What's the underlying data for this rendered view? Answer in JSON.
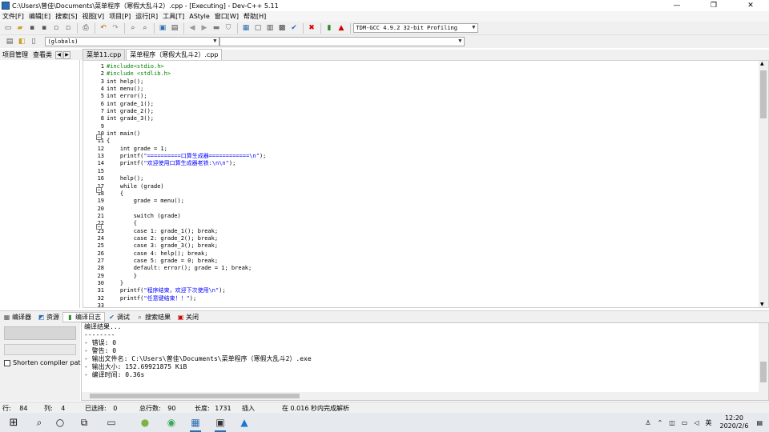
{
  "window": {
    "title": "C:\\Users\\曾佳\\Documents\\菜单程序（寒假大乱斗2）.cpp - [Executing] - Dev-C++ 5.11",
    "minimize": "—",
    "maximize": "❐",
    "close": "✕"
  },
  "menu": [
    "文件[F]",
    "编辑[E]",
    "搜索[S]",
    "视图[V]",
    "项目[P]",
    "运行[R]",
    "工具[T]",
    "AStyle",
    "窗口[W]",
    "帮助[H]"
  ],
  "toolbar": {
    "compiler_select": "TDM-GCC 4.9.2 32-bit Profiling",
    "globals_select": "(globals)"
  },
  "left_tabs": [
    "项目管理",
    "查看类"
  ],
  "editor_tabs": [
    "菜单11.cpp",
    "菜单程序（寒假大乱斗2）.cpp"
  ],
  "code": {
    "line_numbers": [
      "1",
      "2",
      "3",
      "4",
      "5",
      "6",
      "7",
      "8",
      "9",
      "10",
      "11",
      "12",
      "13",
      "14",
      "15",
      "16",
      "17",
      "18",
      "19",
      "20",
      "21",
      "22",
      "23",
      "24",
      "25",
      "26",
      "27",
      "28",
      "29",
      "30",
      "31",
      "32",
      "33"
    ],
    "lines": [
      "#include<stdio.h>",
      "#include <stdlib.h>",
      "int help();",
      "int menu();",
      "int error();",
      "int grade_1();",
      "int grade_2();",
      "int grade_3();",
      "",
      "int main()",
      "{",
      "    int grade = 1;",
      "    printf(\"==========口算生成器============\\n\");",
      "    printf(\"欢迎使用口算生成器老铁:\\n\\n\");",
      "",
      "    help();",
      "    while (grade)",
      "    {",
      "        grade = menu();",
      "",
      "        switch (grade)",
      "        {",
      "        case 1: grade_1(); break;",
      "        case 2: grade_2(); break;",
      "        case 3: grade_3(); break;",
      "        case 4: help(); break;",
      "        case 5: grade = 0; break;",
      "        default: error(); grade = 1; break;",
      "        }",
      "    }",
      "    printf(\"程序结束，欢迎下次使用\\n\");",
      "    printf(\"任意键结束！！\");",
      ""
    ]
  },
  "bottom_tabs": [
    "编译器",
    "资源",
    "编译日志",
    "调试",
    "搜索结果",
    "关闭"
  ],
  "compile_panel": {
    "shorten_label": "Shorten compiler paths",
    "log": [
      "编译结果...",
      "--------",
      "- 错误: 0",
      "- 警告: 0",
      "- 输出文件名: C:\\Users\\曾佳\\Documents\\菜单程序（寒假大乱斗2）.exe",
      "- 输出大小: 152.69921875 KiB",
      "- 编译时间: 0.36s"
    ]
  },
  "status": {
    "row_label": "行:",
    "row": "84",
    "col_label": "列:",
    "col": "4",
    "sel_label": "已选择:",
    "sel": "0",
    "total_label": "总行数:",
    "total": "90",
    "length_label": "长度:",
    "length": "1731",
    "mode": "插入",
    "parse": "在 0.016 秒内完成解析"
  },
  "taskbar": {
    "time": "12:20",
    "date": "2020/2/6",
    "lang": "英"
  }
}
